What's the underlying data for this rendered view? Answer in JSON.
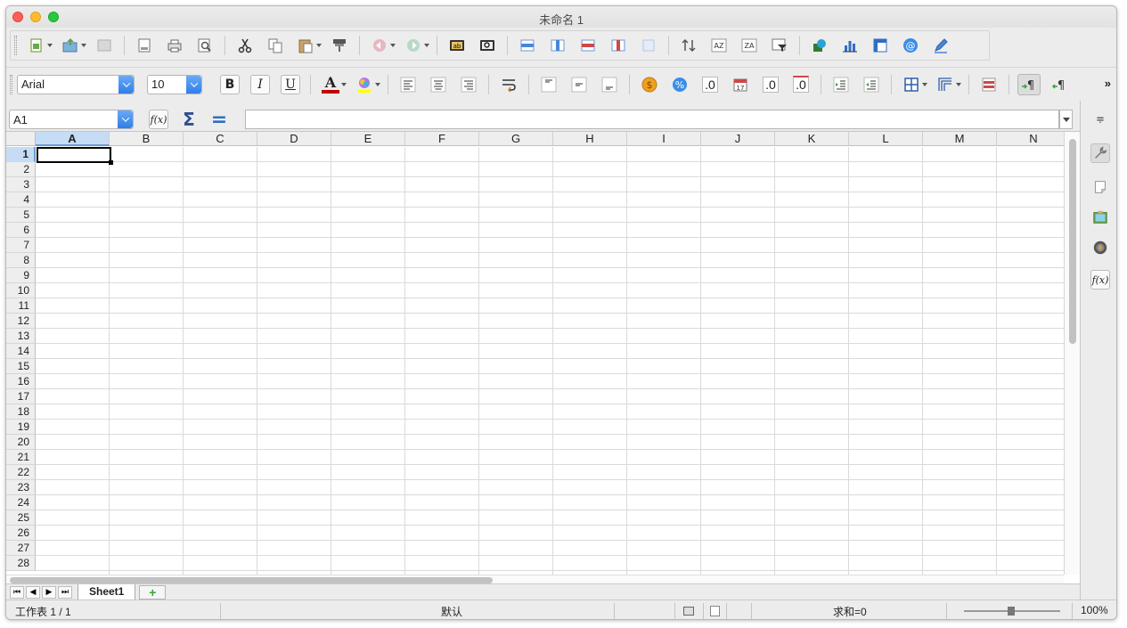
{
  "window": {
    "title": "未命名 1"
  },
  "formatting": {
    "font_name": "Arial",
    "font_size": "10",
    "bold": "B",
    "italic": "I",
    "underline": "U",
    "font_color_glyph": "A",
    "number_format_glyph": ".0",
    "add_decimal_glyph": ".0",
    "remove_decimal_glyph": ".0"
  },
  "formula_bar": {
    "cell_ref": "A1",
    "function_wizard": "f(x)",
    "sum_glyph": "Σ",
    "equals_glyph": "="
  },
  "columns": [
    "A",
    "B",
    "C",
    "D",
    "E",
    "F",
    "G",
    "H",
    "I",
    "J",
    "K",
    "L",
    "M",
    "N"
  ],
  "rows": [
    "1",
    "2",
    "3",
    "4",
    "5",
    "6",
    "7",
    "8",
    "9",
    "10",
    "11",
    "12",
    "13",
    "14",
    "15",
    "16",
    "17",
    "18",
    "19",
    "20",
    "21",
    "22",
    "23",
    "24",
    "25",
    "26",
    "27",
    "28"
  ],
  "active_cell": {
    "col": "A",
    "row": "1"
  },
  "sheets": {
    "tabs": [
      "Sheet1"
    ],
    "add_glyph": "+"
  },
  "status": {
    "sheet_position": "工作表 1 / 1",
    "page_style": "默认",
    "sum": "求和=0",
    "zoom": "100%"
  },
  "sidebar": {
    "function_glyph": "f(x)"
  },
  "colors": {
    "accent": "#2f7fe8",
    "active_header": "#c6dcf5",
    "font_color": "#c00000",
    "highlight": "#ffff00"
  }
}
